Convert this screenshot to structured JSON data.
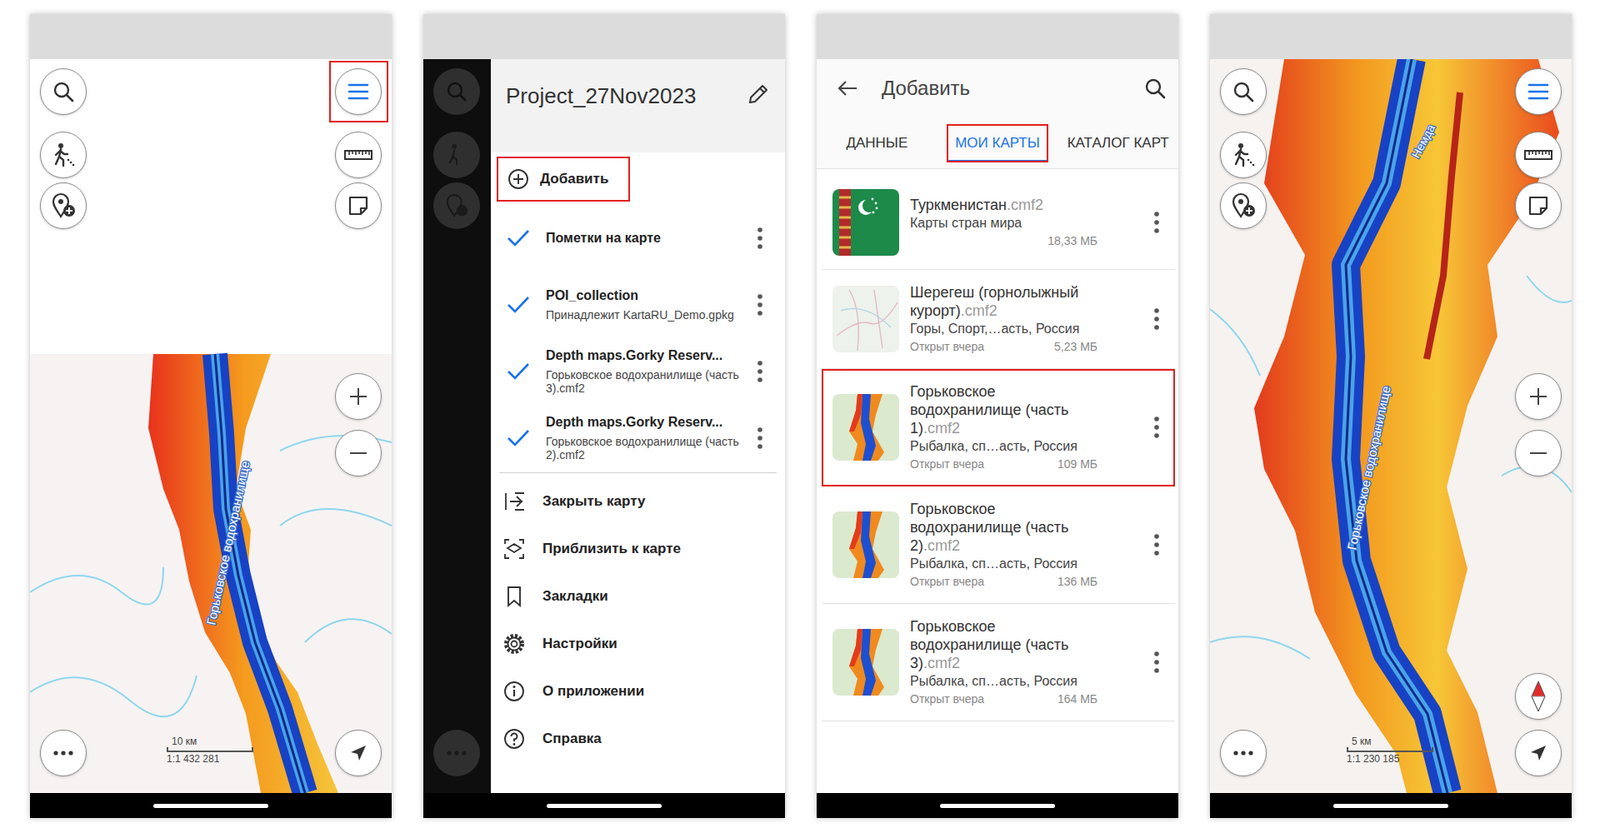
{
  "map_screen": {
    "place_label": "Горьковское водохранилище",
    "scale": {
      "distance": "10 км",
      "ratio": "1:1 432 281"
    },
    "menu_highlighted": true
  },
  "menu": {
    "title": "Project_27Nov2023",
    "add": {
      "label": "Добавить",
      "highlighted": true
    },
    "layers": [
      {
        "title": "Пометки на карте",
        "subtitle": "",
        "checked": true
      },
      {
        "title": "POI_collection",
        "subtitle": "Принадлежит KartaRU_Demo.gpkg",
        "checked": true
      },
      {
        "title": "Depth maps.Gorky Reserv...",
        "subtitle": "Горьковское водохранилище (часть 3).cmf2",
        "checked": true
      },
      {
        "title": "Depth maps.Gorky Reserv...",
        "subtitle": "Горьковское водохранилище (часть 2).cmf2",
        "checked": true
      }
    ],
    "actions": [
      {
        "label": "Закрыть карту",
        "kind": "close"
      },
      {
        "label": "Приблизить к карте",
        "kind": "zoom"
      },
      {
        "label": "Закладки",
        "kind": "bookmark"
      },
      {
        "label": "Настройки",
        "kind": "settings"
      },
      {
        "label": "О приложении",
        "kind": "about"
      },
      {
        "label": "Справка",
        "kind": "help"
      }
    ]
  },
  "add_screen": {
    "title": "Добавить",
    "tabs": [
      {
        "label": "ДАННЫЕ",
        "selected": false,
        "highlighted": false
      },
      {
        "label": "МОИ КАРТЫ",
        "selected": true,
        "highlighted": true
      },
      {
        "label": "КАТАЛОГ КАРТ",
        "selected": false,
        "highlighted": false
      }
    ],
    "maps": [
      {
        "name": "Туркменистан",
        "ext": ".cmf2",
        "tags": "Карты стран мира",
        "opened": "",
        "size": "18,33 МБ",
        "kind": "flag",
        "highlighted": false
      },
      {
        "name": "Шерегеш (горнолыжный курорт)",
        "ext": ".cmf2",
        "tags": "Горы, Спорт,…асть, Россия",
        "opened": "Открыт вчера",
        "size": "5,23 МБ",
        "kind": "map",
        "highlighted": false
      },
      {
        "name": "Горьковское водохранилище (часть 1)",
        "ext": ".cmf2",
        "tags": "Рыбалка, сп…асть, Россия",
        "opened": "Открыт вчера",
        "size": "109 МБ",
        "kind": "depth",
        "highlighted": true
      },
      {
        "name": "Горьковское водохранилище (часть 2)",
        "ext": ".cmf2",
        "tags": "Рыбалка, сп…асть, Россия",
        "opened": "Открыт вчера",
        "size": "136 МБ",
        "kind": "depth",
        "highlighted": false
      },
      {
        "name": "Горьковское водохранилище (часть 3)",
        "ext": ".cmf2",
        "tags": "Рыбалка, сп…асть, Россия",
        "opened": "Открыт вчера",
        "size": "164 МБ",
        "kind": "depth",
        "highlighted": false
      }
    ]
  },
  "zoomed_screen": {
    "labels": [
      "Немда",
      "Горьковское водохранилище"
    ],
    "scale": {
      "distance": "5 км",
      "ratio": "1:1 230 185"
    }
  }
}
